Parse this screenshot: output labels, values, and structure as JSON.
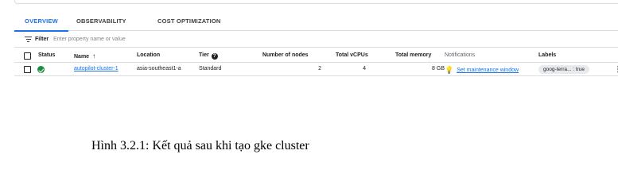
{
  "tabs": [
    {
      "label": "OVERVIEW"
    },
    {
      "label": "OBSERVABILITY"
    },
    {
      "label": "COST OPTIMIZATION"
    }
  ],
  "filter": {
    "label": "Filter",
    "placeholder": "Enter property name or value"
  },
  "table": {
    "headers": {
      "status": "Status",
      "name": "Name",
      "location": "Location",
      "tier": "Tier",
      "nodes": "Number of nodes",
      "vcpus": "Total vCPUs",
      "memory": "Total memory",
      "notifications": "Notifications",
      "labels": "Labels"
    },
    "rows": [
      {
        "name": "autopilot-cluster-1",
        "location": "asia-southeast1-a",
        "tier": "Standard",
        "nodes": "2",
        "vcpus": "4",
        "memory": "8 GB",
        "notification": "Set maintenance window",
        "label": "goog-terra... : true"
      }
    ]
  },
  "icons": {
    "sort": "↑",
    "help": "?",
    "bulb": "💡",
    "kebab": "⋮"
  },
  "caption": "Hình 3.2.1: Kết quả sau khi tạo gke cluster",
  "colors": {
    "accent": "#1a73e8",
    "ok": "#1e8e3e",
    "warn": "#e37400"
  }
}
